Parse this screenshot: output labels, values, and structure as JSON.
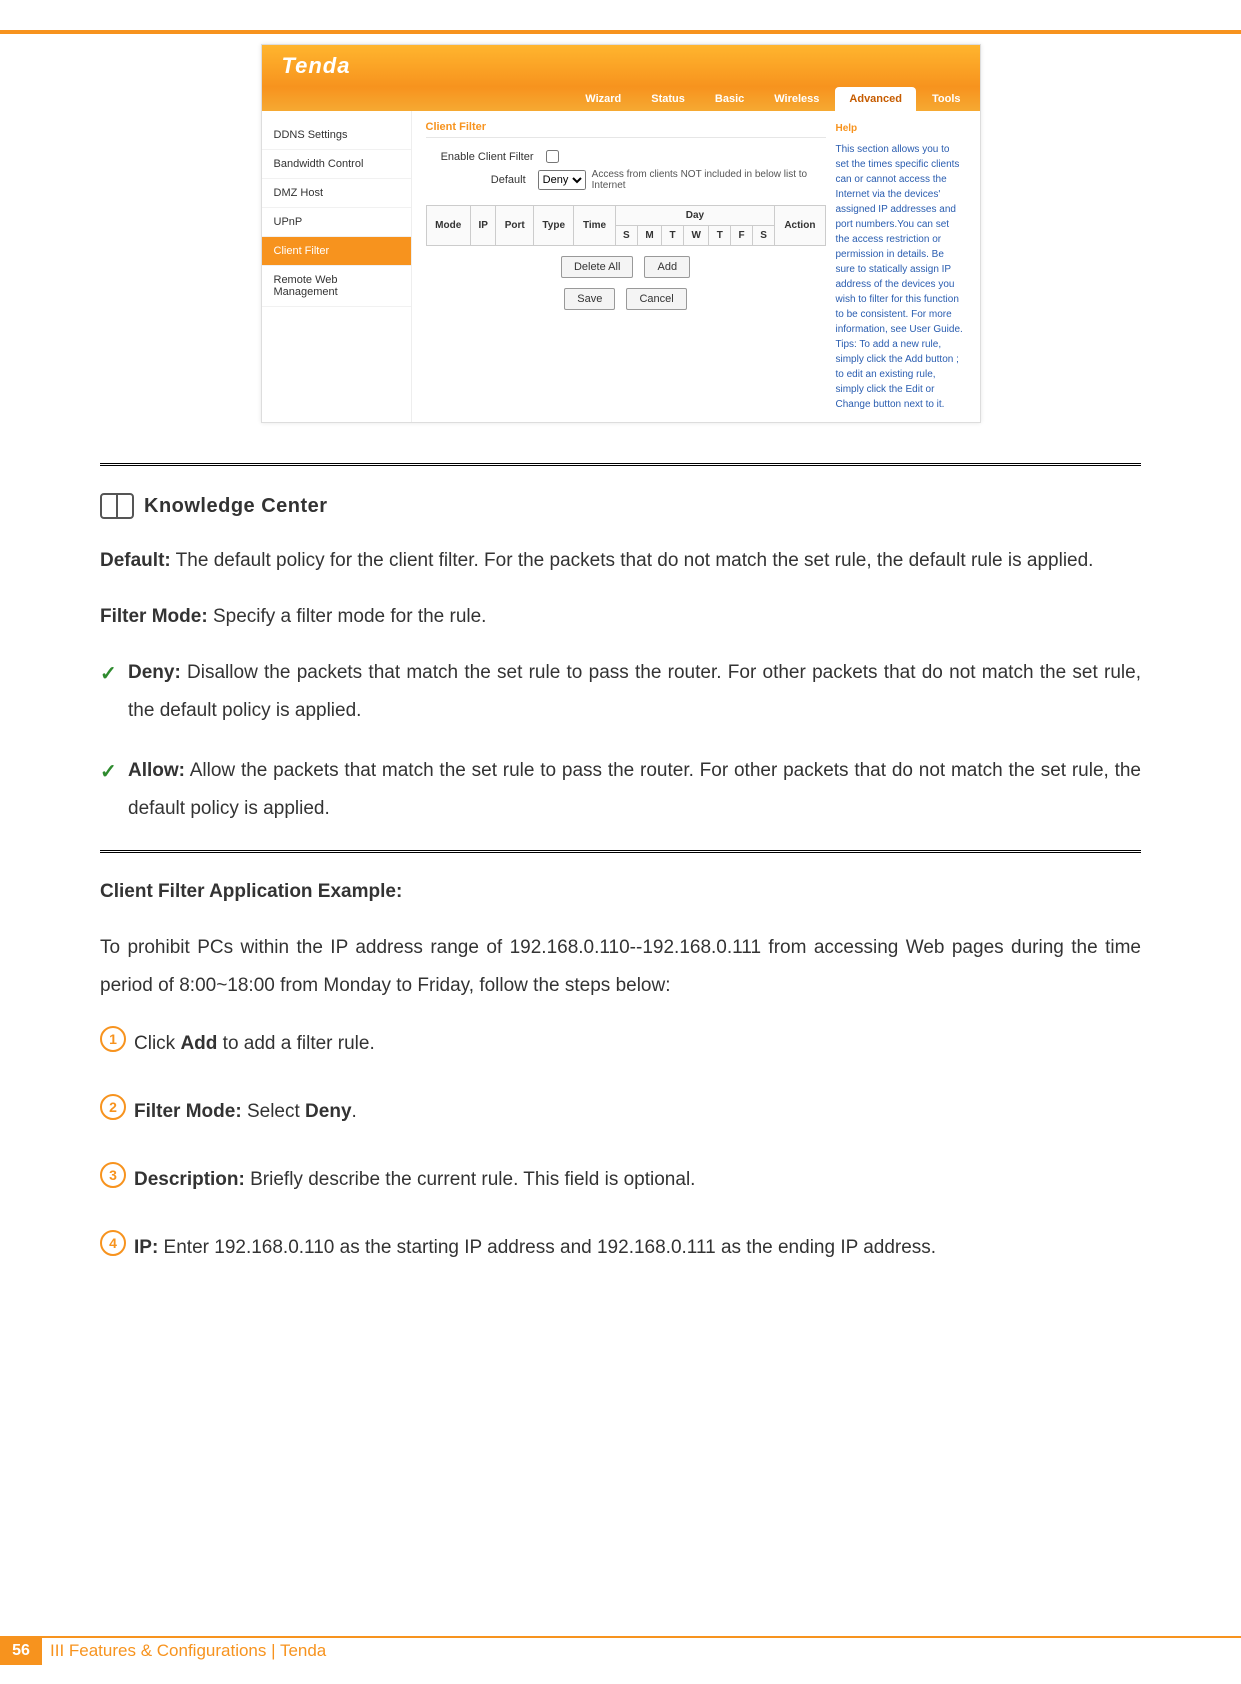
{
  "logo_text": "Tenda",
  "tabs": {
    "wizard": "Wizard",
    "status": "Status",
    "basic": "Basic",
    "wireless": "Wireless",
    "advanced": "Advanced",
    "tools": "Tools"
  },
  "sidebar": {
    "ddns": "DDNS Settings",
    "bw": "Bandwidth Control",
    "dmz": "DMZ Host",
    "upnp": "UPnP",
    "cf": "Client Filter",
    "rwm": "Remote Web Management"
  },
  "panel": {
    "title": "Client Filter",
    "enable_label": "Enable Client Filter",
    "default_label": "Default",
    "default_value": "Deny",
    "default_note": "Access from clients NOT included in below list to Internet",
    "table": {
      "mode": "Mode",
      "ip": "IP",
      "port": "Port",
      "type": "Type",
      "time": "Time",
      "day": "Day",
      "action": "Action",
      "days": {
        "s1": "S",
        "m": "M",
        "t1": "T",
        "w": "W",
        "t2": "T",
        "f": "F",
        "s2": "S"
      }
    },
    "buttons": {
      "delete_all": "Delete All",
      "add": "Add",
      "save": "Save",
      "cancel": "Cancel"
    }
  },
  "help": {
    "title": "Help",
    "text": "This section allows you to set the times specific clients can or cannot access the Internet via the devices' assigned IP addresses and port numbers.You can set the access restriction or permission in details. Be sure to statically assign IP address of the devices you wish to filter for this function to be consistent. For more information, see User Guide. Tips: To add a new rule, simply click the Add button ; to edit an existing rule, simply click the Edit or Change button next to it."
  },
  "kc": {
    "title": "Knowledge Center",
    "default_label": "Default:",
    "default_text": " The default policy for the client filter. For the packets that do not match the set rule, the default rule is applied.",
    "filtermode_label": "Filter Mode:",
    "filtermode_text": " Specify a filter mode for the rule.",
    "deny_label": "Deny:",
    "deny_text": " Disallow the packets that match the set rule to pass the router. For other packets that do not match the set rule, the default policy is applied.",
    "allow_label": "Allow:",
    "allow_text": " Allow the packets that match the set rule to pass the router. For other packets that do not match the set rule, the default policy is applied."
  },
  "example": {
    "title": "Client Filter Application Example:",
    "intro": "To prohibit PCs within the IP address range of 192.168.0.110--192.168.0.111 from accessing Web pages during the time period of 8:00~18:00 from Monday to Friday, follow the steps below:",
    "step1_pre": "Click ",
    "step1_b": "Add",
    "step1_post": " to add a filter rule.",
    "step2_b1": "Filter Mode:",
    "step2_mid": " Select ",
    "step2_b2": "Deny",
    "step2_post": ".",
    "step3_b": "Description:",
    "step3_text": " Briefly describe the current rule. This field is optional.",
    "step4_b": "IP:",
    "step4_text": " Enter 192.168.0.110 as the starting IP address and 192.168.0.111 as the ending IP address."
  },
  "footer": {
    "page": "56",
    "text": "III Features & Configurations | Tenda"
  }
}
